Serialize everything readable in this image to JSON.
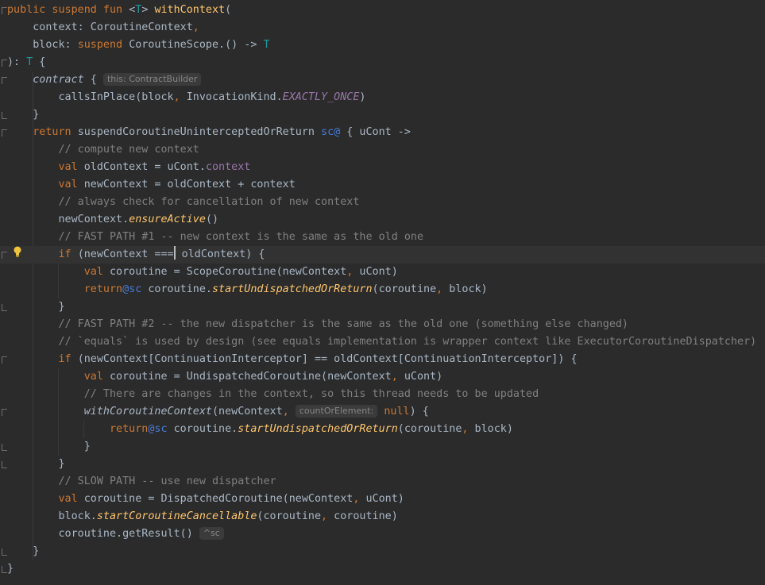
{
  "editor": {
    "hints": {
      "contract_receiver": "this: ContractBuilder",
      "count_or_element": "countOrElement:",
      "return_label": "^sc"
    },
    "lines": [
      {
        "tokens": [
          [
            "kw",
            "public suspend fun "
          ],
          [
            "",
            "<"
          ],
          [
            "tp",
            "T"
          ],
          [
            "",
            "> "
          ],
          [
            "fn",
            "withContext"
          ],
          [
            "",
            "("
          ]
        ]
      },
      {
        "tokens": [
          [
            "",
            "    context: CoroutineContext"
          ],
          [
            "kw",
            ","
          ]
        ]
      },
      {
        "tokens": [
          [
            "",
            "    block: "
          ],
          [
            "kw",
            "suspend "
          ],
          [
            "",
            "CoroutineScope.() -> "
          ],
          [
            "tp",
            "T"
          ]
        ]
      },
      {
        "tokens": [
          [
            "",
            "): "
          ],
          [
            "tp",
            "T"
          ],
          [
            "",
            " {"
          ]
        ]
      },
      {
        "tokens": [
          [
            "",
            "    "
          ],
          [
            "ital",
            "contract"
          ],
          [
            "",
            " { "
          ],
          [
            "hint",
            "this: ContractBuilder"
          ]
        ]
      },
      {
        "tokens": [
          [
            "",
            "        callsInPlace(block"
          ],
          [
            "kw",
            ","
          ],
          [
            "",
            " InvocationKind."
          ],
          [
            "enumc",
            "EXACTLY_ONCE"
          ],
          [
            "",
            ")"
          ]
        ]
      },
      {
        "tokens": [
          [
            "",
            "    }"
          ]
        ]
      },
      {
        "tokens": [
          [
            "kw",
            "    return "
          ],
          [
            "",
            "suspendCoroutineUninterceptedOrReturn "
          ],
          [
            "label",
            "sc@"
          ],
          [
            "",
            " { uCont ->"
          ]
        ]
      },
      {
        "tokens": [
          [
            "com",
            "        // compute new context"
          ]
        ]
      },
      {
        "tokens": [
          [
            "kw",
            "        val "
          ],
          [
            "",
            "oldContext = uCont."
          ],
          [
            "prop",
            "context"
          ]
        ]
      },
      {
        "tokens": [
          [
            "kw",
            "        val "
          ],
          [
            "",
            "newContext = oldContext + context"
          ]
        ]
      },
      {
        "tokens": [
          [
            "com",
            "        // always check for cancellation of new context"
          ]
        ]
      },
      {
        "tokens": [
          [
            "",
            "        newContext."
          ],
          [
            "ext",
            "ensureActive"
          ],
          [
            "",
            "()"
          ]
        ]
      },
      {
        "tokens": [
          [
            "com",
            "        // FAST PATH #1 -- new context is the same as the old one"
          ]
        ]
      },
      {
        "tokens": [
          [
            "kw",
            "        if "
          ],
          [
            "",
            "(newContext ==="
          ],
          [
            "caret",
            ""
          ],
          [
            "",
            " oldContext) {"
          ]
        ],
        "current": true
      },
      {
        "tokens": [
          [
            "kw",
            "            val "
          ],
          [
            "",
            "coroutine = ScopeCoroutine(newContext"
          ],
          [
            "kw",
            ","
          ],
          [
            "",
            " uCont)"
          ]
        ]
      },
      {
        "tokens": [
          [
            "kw",
            "            return"
          ],
          [
            "label",
            "@sc"
          ],
          [
            "",
            " coroutine."
          ],
          [
            "ext",
            "startUndispatchedOrReturn"
          ],
          [
            "",
            "(coroutine"
          ],
          [
            "kw",
            ","
          ],
          [
            "",
            " block)"
          ]
        ]
      },
      {
        "tokens": [
          [
            "",
            "        }"
          ]
        ]
      },
      {
        "tokens": [
          [
            "com",
            "        // FAST PATH #2 -- the new dispatcher is the same as the old one (something else changed)"
          ]
        ]
      },
      {
        "tokens": [
          [
            "com",
            "        // `equals` is used by design (see equals implementation is wrapper context like ExecutorCoroutineDispatcher)"
          ]
        ]
      },
      {
        "tokens": [
          [
            "kw",
            "        if "
          ],
          [
            "",
            "(newContext[ContinuationInterceptor] == oldContext[ContinuationInterceptor]) {"
          ]
        ]
      },
      {
        "tokens": [
          [
            "kw",
            "            val "
          ],
          [
            "",
            "coroutine = UndispatchedCoroutine(newContext"
          ],
          [
            "kw",
            ","
          ],
          [
            "",
            " uCont)"
          ]
        ]
      },
      {
        "tokens": [
          [
            "com",
            "            // There are changes in the context, so this thread needs to be updated"
          ]
        ]
      },
      {
        "tokens": [
          [
            "",
            "            "
          ],
          [
            "ital",
            "withCoroutineContext"
          ],
          [
            "",
            "(newContext"
          ],
          [
            "kw",
            ","
          ],
          [
            "",
            " "
          ],
          [
            "hint",
            "countOrElement:"
          ],
          [
            "",
            ""
          ],
          [
            "kw",
            " null"
          ],
          [
            "",
            ") {"
          ]
        ]
      },
      {
        "tokens": [
          [
            "kw",
            "                return"
          ],
          [
            "label",
            "@sc"
          ],
          [
            "",
            " coroutine."
          ],
          [
            "ext",
            "startUndispatchedOrReturn"
          ],
          [
            "",
            "(coroutine"
          ],
          [
            "kw",
            ","
          ],
          [
            "",
            " block)"
          ]
        ]
      },
      {
        "tokens": [
          [
            "",
            "            }"
          ]
        ]
      },
      {
        "tokens": [
          [
            "",
            "        }"
          ]
        ]
      },
      {
        "tokens": [
          [
            "com",
            "        // SLOW PATH -- use new dispatcher"
          ]
        ]
      },
      {
        "tokens": [
          [
            "kw",
            "        val "
          ],
          [
            "",
            "coroutine = DispatchedCoroutine(newContext"
          ],
          [
            "kw",
            ","
          ],
          [
            "",
            " uCont)"
          ]
        ]
      },
      {
        "tokens": [
          [
            "",
            "        block."
          ],
          [
            "ext",
            "startCoroutineCancellable"
          ],
          [
            "",
            "(coroutine"
          ],
          [
            "kw",
            ","
          ],
          [
            "",
            " coroutine)"
          ]
        ]
      },
      {
        "tokens": [
          [
            "",
            "        coroutine.getResult() "
          ],
          [
            "hint",
            "^sc"
          ]
        ]
      },
      {
        "tokens": [
          [
            "",
            "    }"
          ]
        ]
      },
      {
        "tokens": [
          [
            "",
            "}"
          ]
        ]
      }
    ]
  },
  "gutter": {
    "intention_icon": "lightbulb-icon",
    "fold_marker_icon": "fold-marker-icon"
  },
  "colors": {
    "background": "#2b2b2b",
    "keyword": "#cc7832",
    "function": "#ffc66d",
    "comment": "#808080",
    "property": "#9876aa",
    "type_param": "#20999d",
    "label": "#467cda",
    "text": "#a9b7c6"
  }
}
